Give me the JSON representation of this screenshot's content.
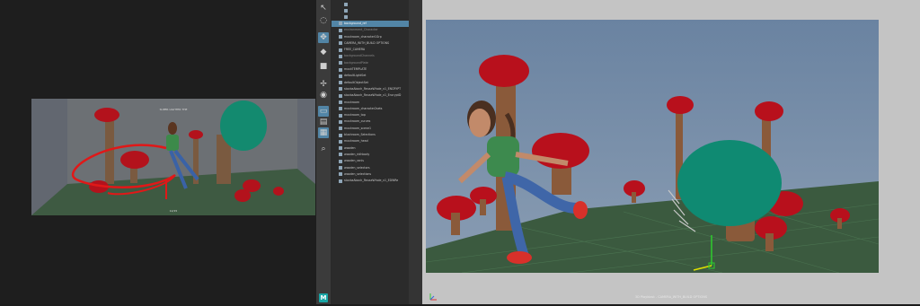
{
  "reference_viewer": {
    "title": "SUPER LIGHTER THE",
    "bottom_label": "12/15"
  },
  "toolbox": {
    "tools": [
      {
        "name": "select-tool",
        "glyph": "↖",
        "active": false
      },
      {
        "name": "lasso-tool",
        "glyph": "◌",
        "active": false
      },
      {
        "name": "move-tool",
        "glyph": "✥",
        "active": true
      },
      {
        "name": "paint-tool",
        "glyph": "◆",
        "active": false
      },
      {
        "name": "rotate-tool",
        "glyph": "■",
        "active": false
      },
      {
        "name": "snap-tool",
        "glyph": "✢",
        "active": false
      },
      {
        "name": "last-tool",
        "glyph": "◉",
        "active": false
      },
      {
        "name": "layout-single",
        "glyph": "▭",
        "active": true
      },
      {
        "name": "layout-split",
        "glyph": "▤",
        "active": false
      },
      {
        "name": "layout-four",
        "glyph": "▦",
        "active": true
      },
      {
        "name": "magnify-tool",
        "glyph": "⌕",
        "active": false
      }
    ]
  },
  "outliner": {
    "items": [
      {
        "label": "",
        "depth": 1,
        "state": "normal"
      },
      {
        "label": "",
        "depth": 1,
        "state": "normal"
      },
      {
        "label": "",
        "depth": 1,
        "state": "normal"
      },
      {
        "label": "background_ref",
        "depth": 0,
        "state": "selected"
      },
      {
        "label": "environment_Character",
        "depth": 0,
        "state": "dim"
      },
      {
        "label": "mushroom_character1Grp",
        "depth": 0,
        "state": "normal"
      },
      {
        "label": "CAMERA_WITH_BUILD OPTIONS",
        "depth": 0,
        "state": "normal"
      },
      {
        "label": "FREE_CAMERA",
        "depth": 0,
        "state": "normal"
      },
      {
        "label": "backgroundChannels",
        "depth": 0,
        "state": "dim"
      },
      {
        "label": "backgroundPlate",
        "depth": 0,
        "state": "dim"
      },
      {
        "label": "mushTEMPLATE",
        "depth": 0,
        "state": "normal"
      },
      {
        "label": "defaultLightSet",
        "depth": 0,
        "state": "normal"
      },
      {
        "label": "defaultObjectSet",
        "depth": 0,
        "state": "normal"
      },
      {
        "label": "stockaAboch_ReuseWhole_v1_ENCRYPT",
        "depth": 0,
        "state": "normal"
      },
      {
        "label": "stockaAboch_ReuseWhole_v1_EncryptD",
        "depth": 0,
        "state": "normal"
      },
      {
        "label": "mushroom",
        "depth": 0,
        "state": "normal"
      },
      {
        "label": "mushroom_character2sets",
        "depth": 0,
        "state": "normal"
      },
      {
        "label": "mushroom_top",
        "depth": 0,
        "state": "normal"
      },
      {
        "label": "mushroom_curves",
        "depth": 0,
        "state": "normal"
      },
      {
        "label": "mushroom_scene1",
        "depth": 0,
        "state": "normal"
      },
      {
        "label": "blushroom_Selections",
        "depth": 0,
        "state": "normal"
      },
      {
        "label": "mushroom_head",
        "depth": 0,
        "state": "normal"
      },
      {
        "label": "wooden",
        "depth": 0,
        "state": "normal"
      },
      {
        "label": "wooden_ridhbody",
        "depth": 0,
        "state": "normal"
      },
      {
        "label": "wooden_ranis",
        "depth": 0,
        "state": "normal"
      },
      {
        "label": "wooden_selectors",
        "depth": 0,
        "state": "normal"
      },
      {
        "label": "wooden_selections",
        "depth": 0,
        "state": "normal"
      },
      {
        "label": "stockaAboch_ReuseWhole_v1_EDWRe",
        "depth": 0,
        "state": "normal"
      }
    ]
  },
  "viewport": {
    "caption": "3D Playblast - CAMERA_WITH_BUILD OPTIONS"
  },
  "app": {
    "logo_letter": "M"
  },
  "colors": {
    "panel_bg": "#2b2b2b",
    "selection": "#5285a6",
    "sky": "#6e86a2",
    "ground": "#3a5a3f",
    "mushroom_cap": "#b8101c",
    "mushroom_stem": "#8a5a3a",
    "teal_mushroom": "#0f8a72"
  }
}
